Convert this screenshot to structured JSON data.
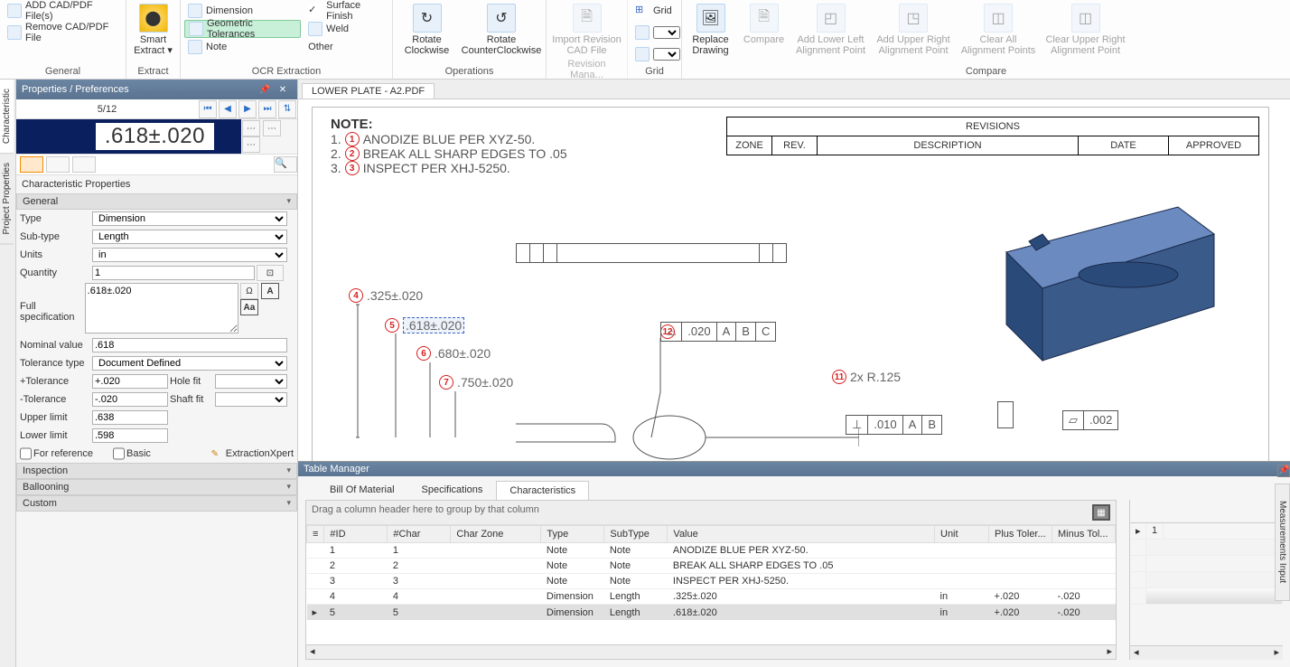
{
  "ribbon": {
    "general": {
      "label": "General",
      "add": "ADD CAD/PDF File(s)",
      "remove": "Remove CAD/PDF File"
    },
    "smartExtract": {
      "top": "Smart",
      "mid": "Extract ▾",
      "bottom": "Extract"
    },
    "ocr": {
      "label": "OCR Extraction",
      "dimension": "Dimension",
      "geotol": "Geometric Tolerances",
      "note": "Note",
      "surface": "Surface Finish",
      "weld": "Weld",
      "other": "Other"
    },
    "ops": {
      "label": "Operations",
      "rotCW": "Rotate Clockwise",
      "rotCCW": "Rotate CounterClockwise"
    },
    "rev": {
      "label": "Revision Mana...",
      "import": "Import Revision CAD File"
    },
    "grid": {
      "label": "Grid",
      "grid": "Grid"
    },
    "compare": {
      "label": "Compare",
      "replace": "Replace Drawing",
      "compare": "Compare",
      "lowerLeft": "Add Lower Left Alignment Point",
      "upperRight": "Add Upper Right Alignment Point",
      "clearAll": "Clear All Alignment Points",
      "clearUR": "Clear Upper Right Alignment Point"
    }
  },
  "sideTabs": {
    "char": "Characteristic",
    "proj": "Project Properties"
  },
  "panel": {
    "title": "Properties / Preferences",
    "nav": "5/12",
    "display": ".618±.020",
    "charPropsTitle": "Characteristic Properties",
    "sections": {
      "general": "General",
      "inspection": "Inspection",
      "ballooning": "Ballooning",
      "custom": "Custom"
    },
    "labels": {
      "type": "Type",
      "subtype": "Sub-type",
      "units": "Units",
      "quantity": "Quantity",
      "fullspec": "Full specification",
      "nominal": "Nominal value",
      "toltype": "Tolerance type",
      "plusTol": "+Tolerance",
      "minusTol": "-Tolerance",
      "holefit": "Hole fit",
      "shaftfit": "Shaft fit",
      "upper": "Upper limit",
      "lower": "Lower limit",
      "forRef": "For reference",
      "basic": "Basic",
      "extract": "ExtractionXpert"
    },
    "values": {
      "type": "Dimension",
      "subtype": "Length",
      "units": "in",
      "quantity": "1",
      "fullspec": ".618±.020",
      "nominal": ".618",
      "toltype": "Document Defined",
      "plusTol": "+.020",
      "minusTol": "-.020",
      "upper": ".638",
      "lower": ".598"
    }
  },
  "doc": {
    "tab": "LOWER PLATE - A2.PDF",
    "notesHeader": "NOTE:",
    "notes": [
      "ANODIZE BLUE PER XYZ-50.",
      "BREAK ALL SHARP EDGES TO .05",
      "INSPECT PER XHJ-5250."
    ],
    "rev": {
      "title": "REVISIONS",
      "zone": "ZONE",
      "rev": "REV.",
      "desc": "DESCRIPTION",
      "date": "DATE",
      "approved": "APPROVED"
    },
    "dims": {
      "d4": ".325±.020",
      "d5": ".618±.020",
      "d6": ".680±.020",
      "d7": ".750±.020",
      "d11": "2x R.125",
      "d12a": ".020",
      "d12b": "A",
      "d12c": "B",
      "d12d": "C",
      "g1a": ".010",
      "g1b": "A",
      "g1c": "B",
      "g2": ".002"
    }
  },
  "tablemgr": {
    "title": "Table Manager",
    "tabs": {
      "bom": "Bill Of Material",
      "spec": "Specifications",
      "chars": "Characteristics"
    },
    "groupHint": "Drag a column header here to group by that column",
    "cols": [
      "#ID",
      "#Char",
      "Char Zone",
      "Type",
      "SubType",
      "Value",
      "Unit",
      "Plus Toler...",
      "Minus Tol..."
    ],
    "rows": [
      {
        "id": "1",
        "char": "1",
        "zone": "",
        "type": "Note",
        "sub": "Note",
        "val": "ANODIZE BLUE PER XYZ-50.",
        "unit": "",
        "pt": "",
        "mt": ""
      },
      {
        "id": "2",
        "char": "2",
        "zone": "",
        "type": "Note",
        "sub": "Note",
        "val": "BREAK ALL SHARP EDGES TO .05",
        "unit": "",
        "pt": "",
        "mt": ""
      },
      {
        "id": "3",
        "char": "3",
        "zone": "",
        "type": "Note",
        "sub": "Note",
        "val": "INSPECT PER XHJ-5250.",
        "unit": "",
        "pt": "",
        "mt": ""
      },
      {
        "id": "4",
        "char": "4",
        "zone": "",
        "type": "Dimension",
        "sub": "Length",
        "val": ".325±.020",
        "unit": "in",
        "pt": "+.020",
        "mt": "-.020"
      },
      {
        "id": "5",
        "char": "5",
        "zone": "",
        "type": "Dimension",
        "sub": "Length",
        "val": ".618±.020",
        "unit": "in",
        "pt": "+.020",
        "mt": "-.020"
      }
    ],
    "miniCol": "1",
    "rightTab": "Measurements Input"
  }
}
